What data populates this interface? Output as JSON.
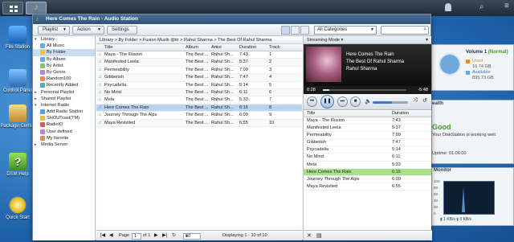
{
  "window": {
    "title": "Here Comes The Rain - Audio Station"
  },
  "toolbar": {
    "playlist": "Playlist",
    "action": "Action",
    "settings": "Settings",
    "category": "All Categories"
  },
  "sidebar": {
    "items": [
      {
        "label": "Library",
        "level": 0,
        "expander": "▾"
      },
      {
        "label": "All Music",
        "level": 1
      },
      {
        "label": "By Folder",
        "level": 1,
        "selected": true
      },
      {
        "label": "By Album",
        "level": 1
      },
      {
        "label": "By Artist",
        "level": 1
      },
      {
        "label": "By Genre",
        "level": 1
      },
      {
        "label": "Random100",
        "level": 1
      },
      {
        "label": "Recently Added",
        "level": 1
      },
      {
        "label": "Personal Playlist",
        "level": 0,
        "expander": "▸"
      },
      {
        "label": "Shared Playlist",
        "level": 0,
        "expander": "▸"
      },
      {
        "label": "Internet Radio",
        "level": 0,
        "expander": "▾"
      },
      {
        "label": "Add Radio Station",
        "level": 1
      },
      {
        "label": "SHOUTcast(TM)",
        "level": 1
      },
      {
        "label": "RadioIO",
        "level": 1
      },
      {
        "label": "User defined",
        "level": 1
      },
      {
        "label": "My favorite",
        "level": 1
      },
      {
        "label": "Media Server",
        "level": 0,
        "expander": "▸"
      }
    ]
  },
  "breadcrumb": "Library > By Folder > Fusion Muzik @itr > Rahul Sharma > The Best Of Rahul Sharma",
  "columns": {
    "title": "Title",
    "album": "Album",
    "artist": "Artist",
    "duration": "Duration",
    "track": "Track"
  },
  "tracks": [
    {
      "title": "Maya - The Illusion",
      "album": "The Best ...",
      "artist": "Rahul Sh...",
      "duration": "7:43",
      "track": "1"
    },
    {
      "title": "Manifested Leela",
      "album": "The Best ...",
      "artist": "Rahul Sh...",
      "duration": "5:37",
      "track": "2"
    },
    {
      "title": "Permeability",
      "album": "The Best ...",
      "artist": "Rahul Sh...",
      "duration": "7:09",
      "track": "3"
    },
    {
      "title": "Gibberish",
      "album": "The Best ...",
      "artist": "Rahul Sh...",
      "duration": "7:47",
      "track": "4"
    },
    {
      "title": "Psycadelia",
      "album": "The Best ...",
      "artist": "Rahul Sh...",
      "duration": "5:14",
      "track": "5"
    },
    {
      "title": "No Mind",
      "album": "The Best ...",
      "artist": "Rahul Sh...",
      "duration": "6:11",
      "track": "6"
    },
    {
      "title": "Mela",
      "album": "The Best ...",
      "artist": "Rahul Sh...",
      "duration": "5:33",
      "track": "7"
    },
    {
      "title": "Here Comes The Rain",
      "album": "The Best ...",
      "artist": "Rahul Sh...",
      "duration": "6:16",
      "track": "8",
      "selected": true
    },
    {
      "title": "Journey Through The Alps",
      "album": "The Best ...",
      "artist": "Rahul Sh...",
      "duration": "6:09",
      "track": "9"
    },
    {
      "title": "Maya Revisited",
      "album": "The Best ...",
      "artist": "Rahul Sh...",
      "duration": "6:55",
      "track": "10"
    }
  ],
  "pager": {
    "page_label": "Page",
    "page_value": "1",
    "of_label": "of 1",
    "page_size": "50",
    "status": "Displaying 1 - 10 of 10"
  },
  "player": {
    "mode": "Streaming Mode",
    "song": "Here Comes The Rain",
    "album": "The Best Of Rahul Sharma",
    "artist": "Rahul Sharma",
    "elapsed": "0:28",
    "remaining": "-5:48",
    "progress": 0.074,
    "volume": 0.55,
    "col_title": "Title",
    "col_duration": "Duration",
    "playlist": [
      {
        "title": "Maya - The Illusion",
        "duration": "7:43"
      },
      {
        "title": "Manifested Leela",
        "duration": "5:37"
      },
      {
        "title": "Permeability",
        "duration": "7:09"
      },
      {
        "title": "Gibberish",
        "duration": "7:47"
      },
      {
        "title": "Psycadelia",
        "duration": "5:14"
      },
      {
        "title": "No Mind",
        "duration": "6:11"
      },
      {
        "title": "Mela",
        "duration": "5:33"
      },
      {
        "title": "Here Comes The Rain",
        "duration": "6:16",
        "playing": true
      },
      {
        "title": "Journey Through The Alps",
        "duration": "6:09"
      },
      {
        "title": "Maya Revisited",
        "duration": "6:55"
      }
    ]
  },
  "desktop": {
    "icons": [
      "File Station",
      "Control Panel",
      "Package Center",
      "DSM Help",
      "Quick Start"
    ]
  },
  "system": {
    "volume_label": "Volume 1",
    "volume_status": "(Normal)",
    "used_label": "Used",
    "used_value": "16.74 GB",
    "available_label": "Available",
    "available_value": "895.73 GB",
    "health_suffix": "ealth",
    "good": "Good",
    "good_text": "Your DiskStation is working well.",
    "uptime": "Uptime: 01:06:00",
    "monitor": "Monitor",
    "axis": [
      "100",
      "80",
      "60",
      "40",
      "20",
      "0"
    ],
    "up_rate": "1 KB/s",
    "down_rate": "0 KB/s"
  },
  "colors": {
    "accent": "#2f5479",
    "selected_row": "#b9d3f0",
    "playing_row": "#a6e28a",
    "good": "#3f9b1a"
  }
}
